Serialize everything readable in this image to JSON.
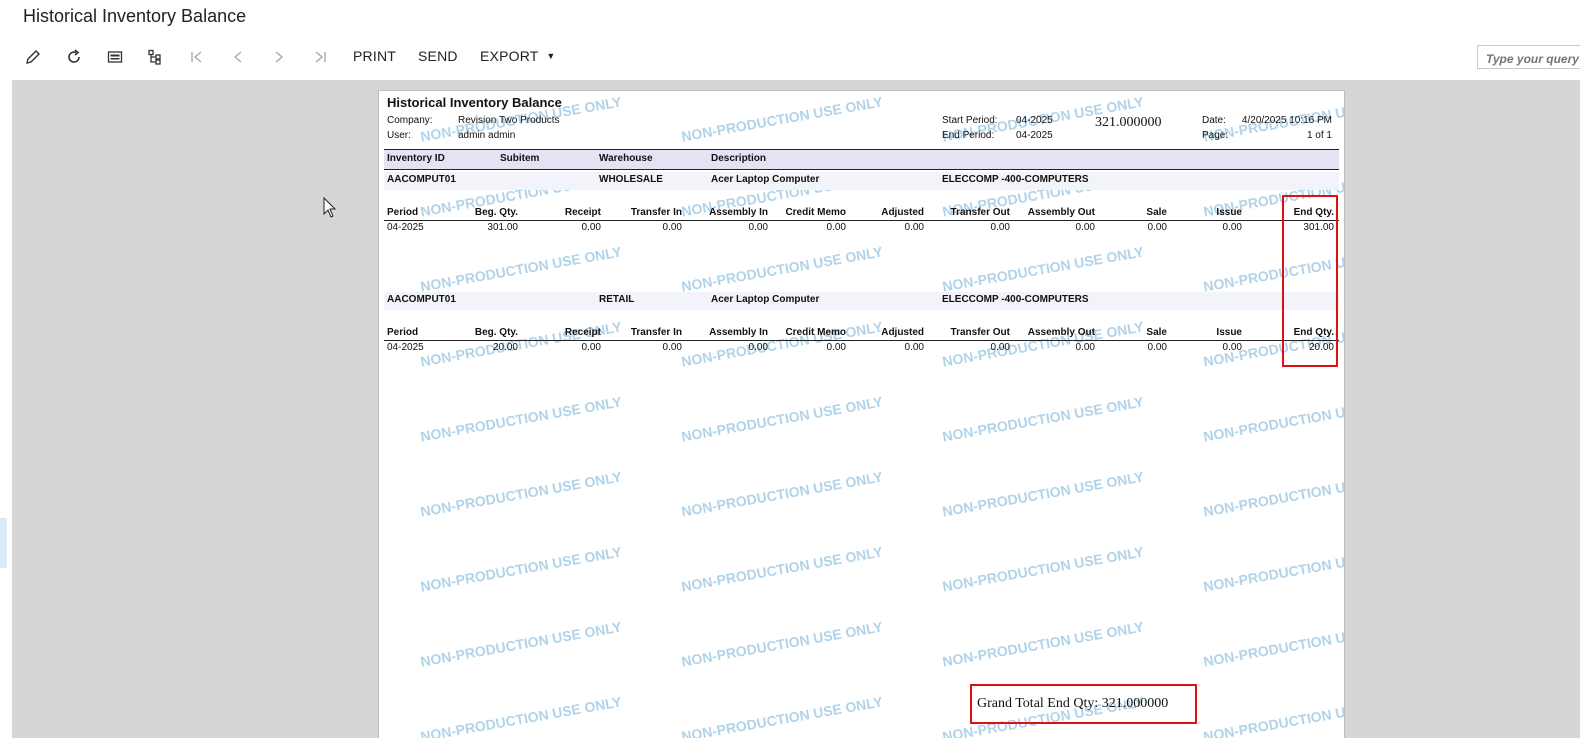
{
  "app": {
    "title": "Historical Inventory Balance"
  },
  "toolbar": {
    "print_label": "PRINT",
    "send_label": "SEND",
    "export_label": "EXPORT",
    "search_placeholder": "Type your query"
  },
  "report": {
    "title": "Historical Inventory Balance",
    "company_label": "Company:",
    "company_value": "Revision Two Products",
    "user_label": "User:",
    "user_value": "admin admin",
    "start_period_label": "Start Period:",
    "start_period_value": "04-2025",
    "end_period_label": "End Period:",
    "end_period_value": "04-2025",
    "total_top": "321.000000",
    "date_label": "Date:",
    "date_value": "4/20/2025 10:16 PM",
    "page_label": "Page:",
    "page_value": "1 of 1",
    "header_cols": [
      "Inventory ID",
      "Subitem",
      "Warehouse",
      "Description"
    ],
    "detail_cols": [
      "Period",
      "Beg. Qty.",
      "Receipt",
      "Transfer In",
      "Assembly In",
      "Credit Memo",
      "Adjusted",
      "Transfer Out",
      "Assembly Out",
      "Sale",
      "Issue",
      "End Qty."
    ],
    "groups": [
      {
        "inventory_id": "AACOMPUT01",
        "warehouse": "WHOLESALE",
        "description": "Acer Laptop Computer",
        "account": "ELECCOMP -400-COMPUTERS",
        "row": [
          "04-2025",
          "301.00",
          "0.00",
          "0.00",
          "0.00",
          "0.00",
          "0.00",
          "0.00",
          "0.00",
          "0.00",
          "0.00",
          "301.00"
        ]
      },
      {
        "inventory_id": "AACOMPUT01",
        "warehouse": "RETAIL",
        "description": "Acer Laptop Computer",
        "account": "ELECCOMP -400-COMPUTERS",
        "row": [
          "04-2025",
          "20.00",
          "0.00",
          "0.00",
          "0.00",
          "0.00",
          "0.00",
          "0.00",
          "0.00",
          "0.00",
          "0.00",
          "20.00"
        ]
      }
    ],
    "grand_total": "Grand Total End Qty: 321.000000",
    "watermark": "NON-PRODUCTION USE ONLY"
  },
  "colors": {
    "highlight": "#dd1111",
    "watermark": "#a9cfe8",
    "header_band": "#e3e3f3"
  }
}
